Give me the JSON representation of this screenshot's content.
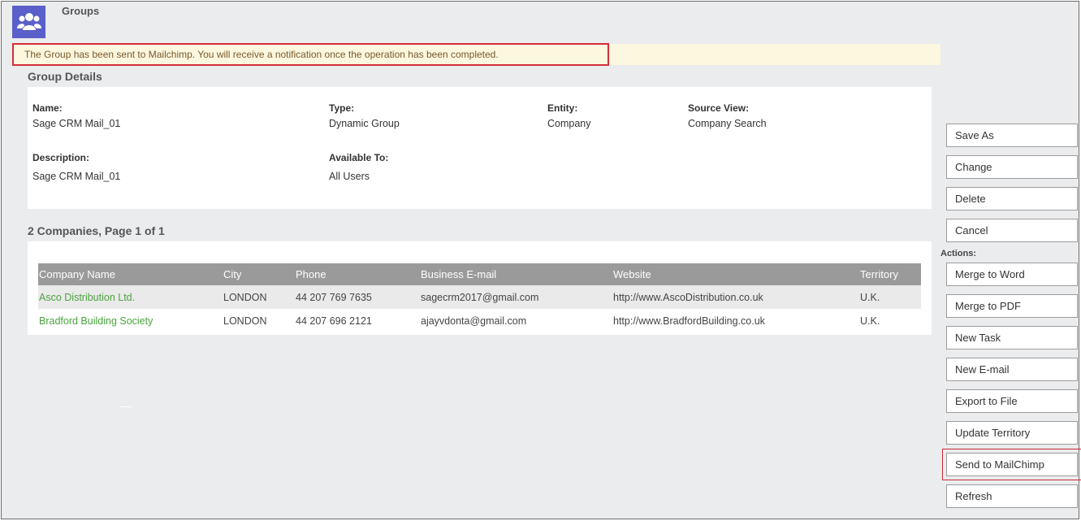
{
  "header": {
    "title": "Groups",
    "icon": "groups-icon",
    "icon_color": "#5a5fc9"
  },
  "notice": {
    "text": "The Group has been sent to Mailchimp. You will receive a notification once the operation has been completed."
  },
  "details": {
    "title": "Group Details",
    "name_label": "Name:",
    "name_value": "Sage CRM Mail_01",
    "type_label": "Type:",
    "type_value": "Dynamic Group",
    "entity_label": "Entity:",
    "entity_value": "Company",
    "source_label": "Source View:",
    "source_value": "Company Search",
    "desc_label": "Description:",
    "desc_value": "Sage CRM Mail_01",
    "avail_label": "Available To:",
    "avail_value": "All Users"
  },
  "list": {
    "title": "2 Companies, Page 1 of 1",
    "columns": [
      "Company Name",
      "City",
      "Phone",
      "Business E-mail",
      "Website",
      "Territory"
    ],
    "rows": [
      {
        "company": "Asco Distribution Ltd.",
        "city": "LONDON",
        "phone": "44 207 769 7635",
        "email": "sagecrm2017@gmail.com",
        "website": "http://www.AscoDistribution.co.uk",
        "territory": "U.K."
      },
      {
        "company": "Bradford Building Society",
        "city": "LONDON",
        "phone": "44 207 696 2121",
        "email": "ajayvdonta@gmail.com",
        "website": "http://www.BradfordBuilding.co.uk",
        "territory": "U.K."
      }
    ]
  },
  "sidebar": {
    "save_as": "Save As",
    "change": "Change",
    "delete": "Delete",
    "cancel": "Cancel",
    "actions_label": "Actions:",
    "merge_word": "Merge to Word",
    "merge_pdf": "Merge to PDF",
    "new_task": "New Task",
    "new_email": "New E-mail",
    "export_file": "Export to File",
    "update_territory": "Update Territory",
    "send_mailchimp": "Send to MailChimp",
    "refresh": "Refresh"
  },
  "colors": {
    "link": "#4aa33e",
    "highlight": "#d32f3a",
    "notice_bg": "#fcf7df"
  }
}
